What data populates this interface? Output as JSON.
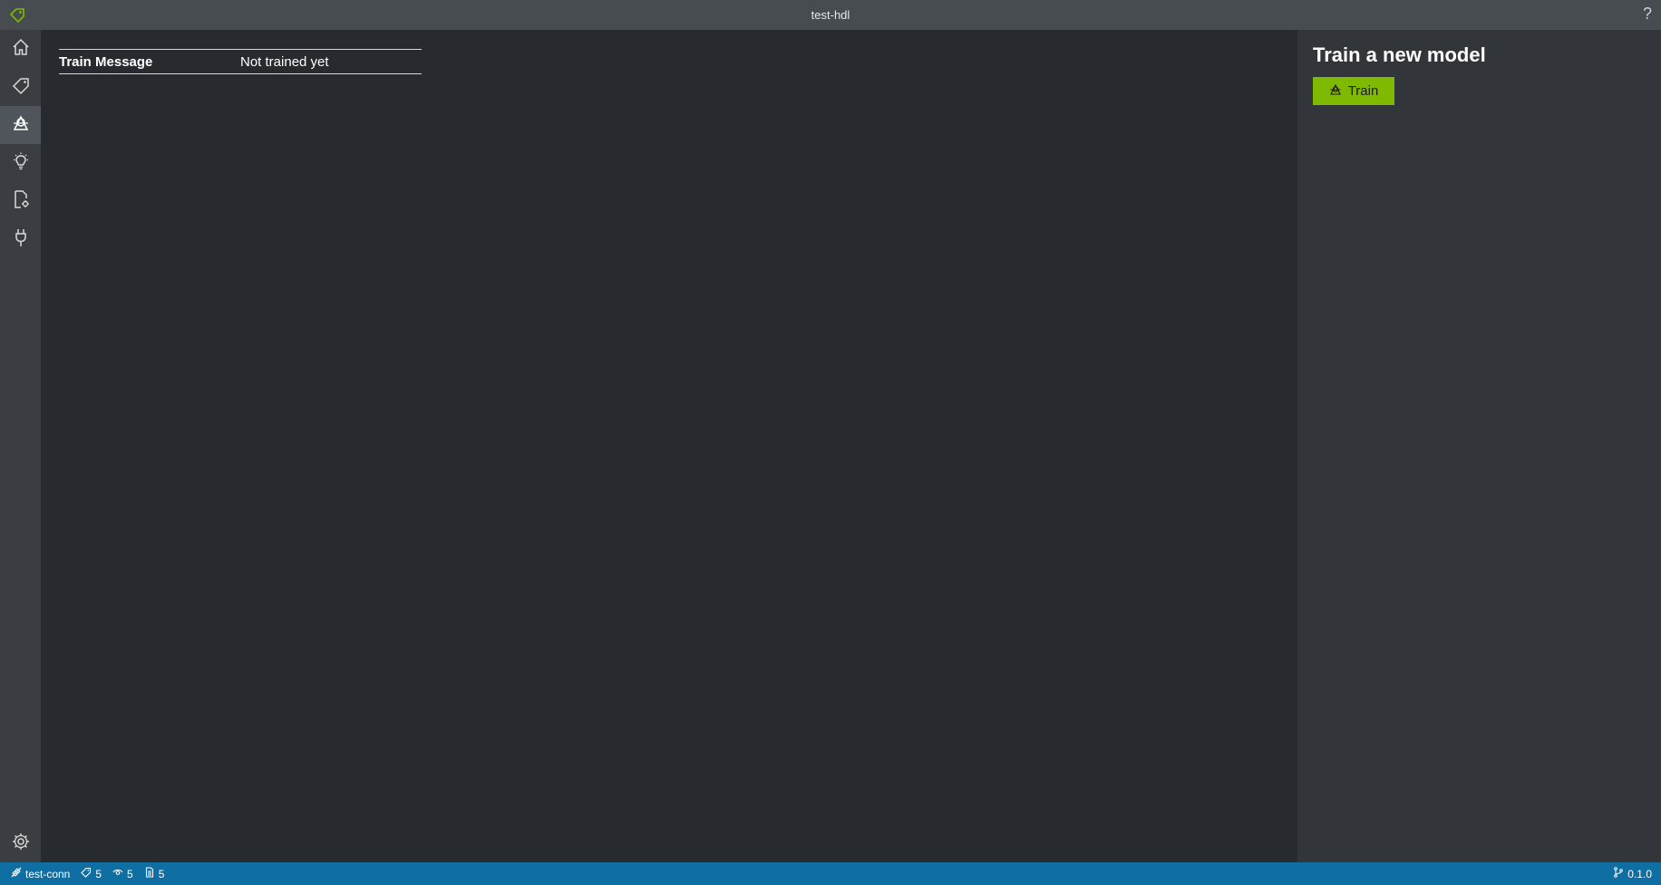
{
  "window": {
    "title": "test-hdl",
    "help_label": "?",
    "logo_icon": "tag-icon"
  },
  "sidebar": {
    "items": [
      {
        "name": "home",
        "icon": "home-icon",
        "active": false
      },
      {
        "name": "tags",
        "icon": "tag-icon",
        "active": false
      },
      {
        "name": "train",
        "icon": "train-icon",
        "active": true
      },
      {
        "name": "predict",
        "icon": "lightbulb-icon",
        "active": false
      },
      {
        "name": "settings-file",
        "icon": "file-gear-icon",
        "active": false
      },
      {
        "name": "connections",
        "icon": "plug-icon",
        "active": false
      }
    ],
    "bottom_icon": "gear-icon"
  },
  "main": {
    "train_table": {
      "header": "Train Message",
      "value": "Not trained yet"
    }
  },
  "right_panel": {
    "title": "Train a new model",
    "train_button_label": "Train"
  },
  "statusbar": {
    "connection": "test-conn",
    "tags_count": "5",
    "visited_count": "5",
    "assets_count": "5",
    "version": "0.1.0"
  },
  "colors": {
    "accent": "#7fba00",
    "statusbar": "#0f6ea2",
    "titlebar": "#474c51",
    "sidebar": "#3a3e42",
    "main_bg": "#272b30",
    "right_panel_bg": "#32363a"
  }
}
